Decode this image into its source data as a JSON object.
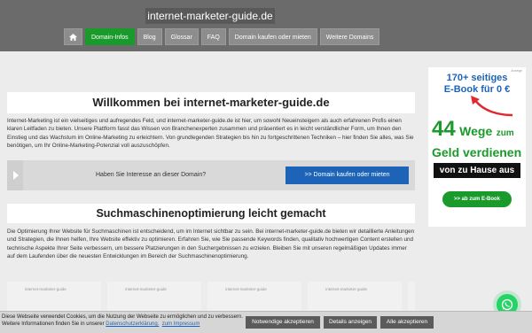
{
  "header": {
    "site_title": "internet-marketer-guide.de",
    "nav": [
      {
        "label": "",
        "icon": "home-icon"
      },
      {
        "label": "Domain-Infos",
        "active": true
      },
      {
        "label": "Blog"
      },
      {
        "label": "Glossar"
      },
      {
        "label": "FAQ"
      },
      {
        "label": "Domain kaufen oder mieten"
      },
      {
        "label": "Weitere Domains"
      }
    ]
  },
  "main": {
    "welcome_title": "Willkommen bei internet-marketer-guide.de",
    "intro": "Internet-Marketing ist ein vielseitiges und aufregendes Feld, und internet-marketer-guide.de ist hier, um sowohl Neueinsteigern als auch erfahrenen Profis einen klaren Leitfaden zu bieten. Unsere Plattform fasst das Wissen von Branchenexperten zusammen und präsentiert es in leicht verständlicher Form, um Ihnen den Einstieg und das Wachstum im Online-Marketing zu erleichtern. Von grundlegenden Strategien bis hin zu fortgeschrittenen Techniken – hier finden Sie alles, was Sie benötigen, um Ihr Online-Marketing-Potenzial voll auszuschöpfen.",
    "domain_question": "Haben Sie Interesse an dieser Domain?",
    "domain_button": ">> Domain kaufen oder mieten",
    "seo_title": "Suchmaschinenoptimierung leicht gemacht",
    "seo_text": "Die Optimierung Ihrer Website für Suchmaschinen ist entscheidend, um im Internet sichtbar zu sein. Bei internet-marketer-guide.de bieten wir detaillierte Anleitungen und Strategien, die Ihnen helfen, Ihre Website effektiv zu optimieren. Erfahren Sie, wie Sie passende Keywords finden, qualitativ hochwertigen Content erstellen und technische Aspekte Ihrer Seite verbessern, um bessere Platzierungen in den Suchergebnissen zu erzielen. Bleiben Sie mit unseren regelmäßigen Updates immer auf dem Laufenden über die neuesten Entwicklungen im Bereich der Suchmaschinenoptimierung.",
    "thumbs": [
      "internet-marketer-guide",
      "internet-marketer-guide",
      "internet-marketer-guide",
      "internet-marketer-guide"
    ]
  },
  "ad": {
    "label": "Anzeige",
    "line1": "170+ seitiges",
    "line2": "E-Book für 0 €",
    "big_number": "44",
    "wege": "Wege",
    "zum": "zum",
    "geld": "Geld verdienen",
    "haus": "von zu Hause aus",
    "button": ">> ab zum E-Book"
  },
  "cookie": {
    "text1": "Diese Webseite verwendet Cookies, um die Nutzung der Webseite zu ermöglichen und zu verbessern.",
    "text2": "Weitere Informationen finden Sie in unserer",
    "privacy_link": "Datenschutzerklärung.",
    "impressum_link": "zum Impressum",
    "btn_necessary": "Notwendige akzeptieren",
    "btn_details": "Details anzeigen",
    "btn_all": "Alle akzeptieren"
  },
  "colors": {
    "header_bg": "#6b6b6b",
    "nav_active": "#1a9a2a",
    "primary_blue": "#1d64b8",
    "whatsapp_green": "#25d366"
  }
}
